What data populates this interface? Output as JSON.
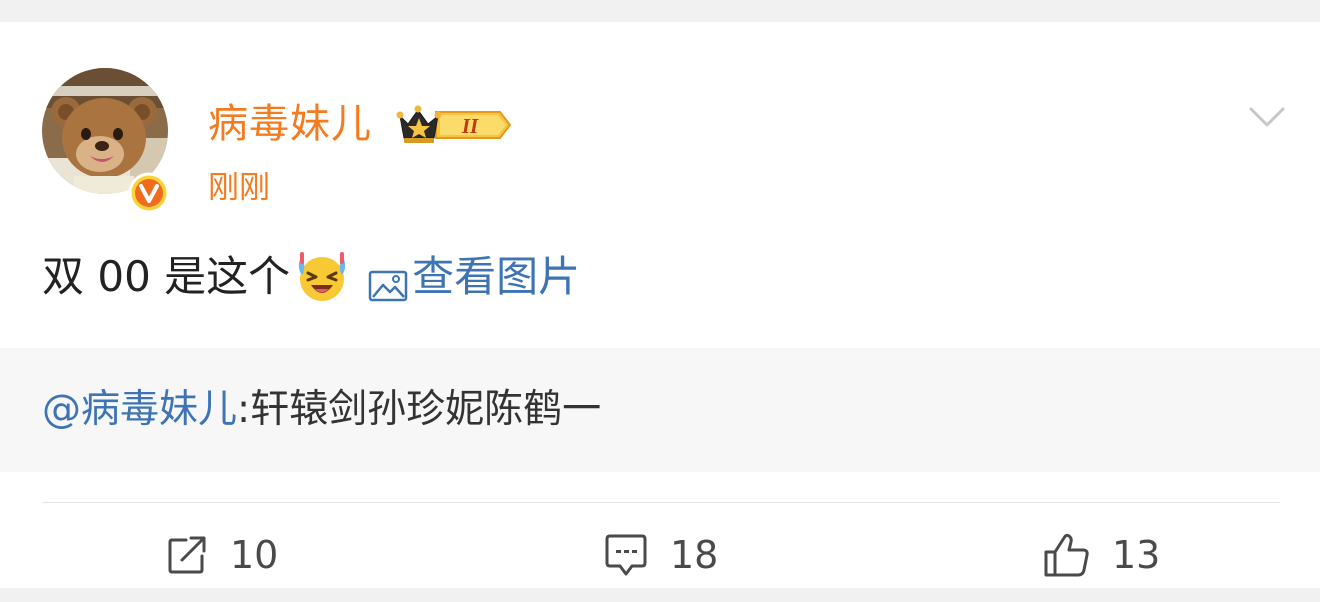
{
  "post": {
    "username": "病毒妹儿",
    "member_badge_level": "II",
    "timestamp": "刚刚",
    "text": "双 00 是这个",
    "view_image_label": "查看图片"
  },
  "quote": {
    "mention": "@病毒妹儿",
    "text": ":轩辕剑孙珍妮陈鹤一"
  },
  "actions": {
    "reposts": "10",
    "comments": "18",
    "likes": "13"
  },
  "colors": {
    "username": "#f47b1e",
    "link": "#3e74b3",
    "text": "#222222",
    "quote_bg": "#f7f7f7",
    "page_bg": "#f1f1f1"
  },
  "icons": {
    "avatar": "bear-avatar",
    "verified": "vip-v-badge",
    "member": "crown-icon",
    "menu": "chevron-down-icon",
    "emoji": "laughing-tears-emoji",
    "image": "image-icon",
    "repost": "repost-icon",
    "comment": "comment-icon",
    "like": "thumbs-up-icon"
  }
}
